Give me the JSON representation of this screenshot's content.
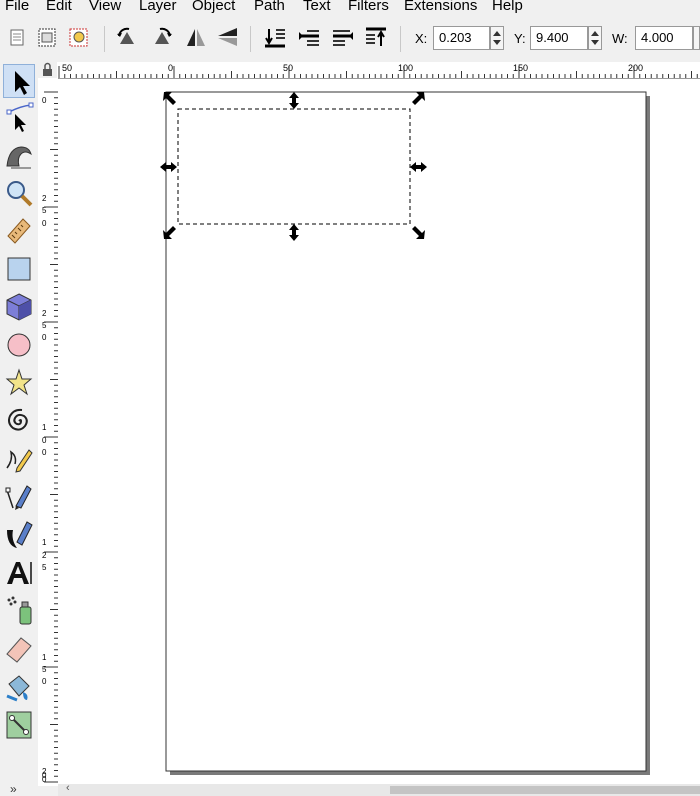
{
  "menu": [
    "File",
    "Edit",
    "View",
    "Layer",
    "Object",
    "Path",
    "Text",
    "Filters",
    "Extensions",
    "Help"
  ],
  "coords": {
    "x_label": "X:",
    "x_value": "0.203",
    "y_label": "Y:",
    "y_value": "9.400",
    "w_label": "W:",
    "w_value": "4.000"
  },
  "ruler": {
    "h_labels": [
      "50",
      "0",
      "50",
      "100",
      "150",
      "200"
    ],
    "v_labels": [
      "0",
      "2",
      "5",
      "0",
      "2",
      "5",
      "0",
      "1",
      "0",
      "0",
      "1",
      "2",
      "5",
      "1",
      "5",
      "0",
      "2",
      "0",
      "0"
    ]
  },
  "toolbox": {
    "tools": [
      "selector-tool",
      "node-tool",
      "tweak-tool",
      "zoom-tool",
      "measure-tool",
      "rectangle-tool",
      "3d-box-tool",
      "ellipse-tool",
      "star-tool",
      "spiral-tool",
      "pencil-tool",
      "pen-tool",
      "calligraphy-tool",
      "text-tool",
      "spray-tool",
      "eraser-tool",
      "paint-bucket-tool",
      "connector-tool"
    ],
    "expand_label": "»"
  },
  "colors": {
    "selection_dash": "#000000",
    "active_tool": "#cfe0f5",
    "page_shadow": "#7a7a7a"
  }
}
